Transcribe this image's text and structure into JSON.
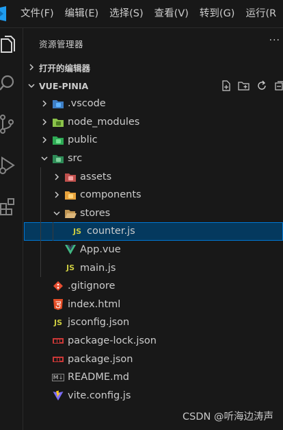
{
  "menubar": {
    "items": [
      "文件(F)",
      "编辑(E)",
      "选择(S)",
      "查看(V)",
      "转到(G)",
      "运行(R"
    ]
  },
  "activitybar": {
    "icons": [
      "explorer-icon",
      "search-icon",
      "source-control-icon",
      "run-debug-icon",
      "extensions-icon"
    ]
  },
  "sidebar": {
    "title": "资源管理器",
    "more": "···",
    "open_editors_label": "打开的编辑器",
    "project_label": "VUE-PINIA",
    "actions": [
      "new-file-icon",
      "new-folder-icon",
      "refresh-icon",
      "collapse-all-icon"
    ]
  },
  "tree": [
    {
      "label": ".vscode",
      "icon": "vscode-folder-icon",
      "type": "folder",
      "expanded": false,
      "depth": 0
    },
    {
      "label": "node_modules",
      "icon": "node-modules-folder-icon",
      "type": "folder",
      "expanded": false,
      "depth": 0
    },
    {
      "label": "public",
      "icon": "public-folder-icon",
      "type": "folder",
      "expanded": false,
      "depth": 0
    },
    {
      "label": "src",
      "icon": "src-folder-icon",
      "type": "folder",
      "expanded": true,
      "depth": 0
    },
    {
      "label": "assets",
      "icon": "assets-folder-icon",
      "type": "folder",
      "expanded": false,
      "depth": 1
    },
    {
      "label": "components",
      "icon": "components-folder-icon",
      "type": "folder",
      "expanded": false,
      "depth": 1
    },
    {
      "label": "stores",
      "icon": "stores-folder-icon",
      "type": "folder",
      "expanded": true,
      "depth": 1
    },
    {
      "label": "counter.js",
      "icon": "js-file-icon",
      "type": "file",
      "depth": 2,
      "selected": true
    },
    {
      "label": "App.vue",
      "icon": "vue-file-icon",
      "type": "file",
      "depth": 1
    },
    {
      "label": "main.js",
      "icon": "js-file-icon",
      "type": "file",
      "depth": 1
    },
    {
      "label": ".gitignore",
      "icon": "git-file-icon",
      "type": "file",
      "depth": 0
    },
    {
      "label": "index.html",
      "icon": "html-file-icon",
      "type": "file",
      "depth": 0
    },
    {
      "label": "jsconfig.json",
      "icon": "jsconfig-file-icon",
      "type": "file",
      "depth": 0
    },
    {
      "label": "package-lock.json",
      "icon": "npm-lock-file-icon",
      "type": "file",
      "depth": 0
    },
    {
      "label": "package.json",
      "icon": "npm-file-icon",
      "type": "file",
      "depth": 0
    },
    {
      "label": "README.md",
      "icon": "markdown-file-icon",
      "type": "file",
      "depth": 0
    },
    {
      "label": "vite.config.js",
      "icon": "vite-file-icon",
      "type": "file",
      "depth": 0
    }
  ],
  "icon_text": {
    "js": "JS",
    "md": "M↓"
  },
  "colors": {
    "background": "#181818",
    "selection": "#04395e",
    "selection_border": "#0078d4",
    "js": "#cbcb41",
    "vue": "#41b883",
    "html": "#e44d26",
    "git": "#e84e31",
    "npm": "#cb3837"
  },
  "watermark": "CSDN @听海边涛声"
}
